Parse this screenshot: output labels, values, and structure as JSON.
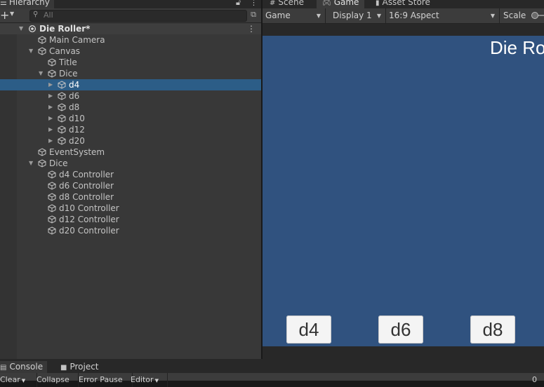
{
  "hierarchy": {
    "tab_label": "Hierarchy",
    "tab_icon": "list-icon",
    "add_label": "+",
    "search_placeholder": "All",
    "rows": [
      {
        "label": "Die Roller*",
        "depth": 0,
        "fold": "expanded",
        "icon": "unity-scene-icon",
        "root": true,
        "selected": false
      },
      {
        "label": "Main Camera",
        "depth": 1,
        "fold": "none",
        "icon": "gameobject-cube-icon",
        "selected": false
      },
      {
        "label": "Canvas",
        "depth": 1,
        "fold": "expanded",
        "icon": "gameobject-cube-icon",
        "selected": false
      },
      {
        "label": "Title",
        "depth": 2,
        "fold": "none",
        "icon": "gameobject-cube-icon",
        "selected": false
      },
      {
        "label": "Dice",
        "depth": 2,
        "fold": "expanded",
        "icon": "gameobject-cube-icon",
        "selected": false
      },
      {
        "label": "d4",
        "depth": 3,
        "fold": "collapsed",
        "icon": "gameobject-cube-icon",
        "selected": true
      },
      {
        "label": "d6",
        "depth": 3,
        "fold": "collapsed",
        "icon": "gameobject-cube-icon",
        "selected": false
      },
      {
        "label": "d8",
        "depth": 3,
        "fold": "collapsed",
        "icon": "gameobject-cube-icon",
        "selected": false
      },
      {
        "label": "d10",
        "depth": 3,
        "fold": "collapsed",
        "icon": "gameobject-cube-icon",
        "selected": false
      },
      {
        "label": "d12",
        "depth": 3,
        "fold": "collapsed",
        "icon": "gameobject-cube-icon",
        "selected": false
      },
      {
        "label": "d20",
        "depth": 3,
        "fold": "collapsed",
        "icon": "gameobject-cube-icon",
        "selected": false
      },
      {
        "label": "EventSystem",
        "depth": 1,
        "fold": "none",
        "icon": "gameobject-cube-icon",
        "selected": false
      },
      {
        "label": "Dice",
        "depth": 1,
        "fold": "expanded",
        "icon": "gameobject-cube-icon",
        "selected": false
      },
      {
        "label": "d4 Controller",
        "depth": 2,
        "fold": "none",
        "icon": "gameobject-cube-icon",
        "selected": false
      },
      {
        "label": "d6 Controller",
        "depth": 2,
        "fold": "none",
        "icon": "gameobject-cube-icon",
        "selected": false
      },
      {
        "label": "d8 Controller",
        "depth": 2,
        "fold": "none",
        "icon": "gameobject-cube-icon",
        "selected": false
      },
      {
        "label": "d10 Controller",
        "depth": 2,
        "fold": "none",
        "icon": "gameobject-cube-icon",
        "selected": false
      },
      {
        "label": "d12 Controller",
        "depth": 2,
        "fold": "none",
        "icon": "gameobject-cube-icon",
        "selected": false
      },
      {
        "label": "d20 Controller",
        "depth": 2,
        "fold": "none",
        "icon": "gameobject-cube-icon",
        "selected": false
      }
    ]
  },
  "editor_tabs": [
    {
      "label": "Scene",
      "icon": "hash-icon",
      "active": false
    },
    {
      "label": "Game",
      "icon": "gamepad-icon",
      "active": true
    },
    {
      "label": "Asset Store",
      "icon": "shopping-bag-icon",
      "active": false
    }
  ],
  "game_toolbar": {
    "mode": "Game",
    "display": "Display 1",
    "aspect": "16:9 Aspect",
    "scale_label": "Scale"
  },
  "game_view": {
    "title": "Die Ro",
    "buttons": [
      "d4",
      "d6",
      "d8"
    ],
    "background": "#30527f"
  },
  "console": {
    "tabs": [
      {
        "label": "Console",
        "icon": "console-icon",
        "active": true
      },
      {
        "label": "Project",
        "icon": "folder-icon",
        "active": false
      }
    ],
    "toolbar": [
      "Clear",
      "Collapse",
      "Error Pause",
      "Editor"
    ],
    "count": "0"
  },
  "colors": {
    "selection": "#2c5d87",
    "panel": "#383838",
    "game_background": "#30527f"
  }
}
